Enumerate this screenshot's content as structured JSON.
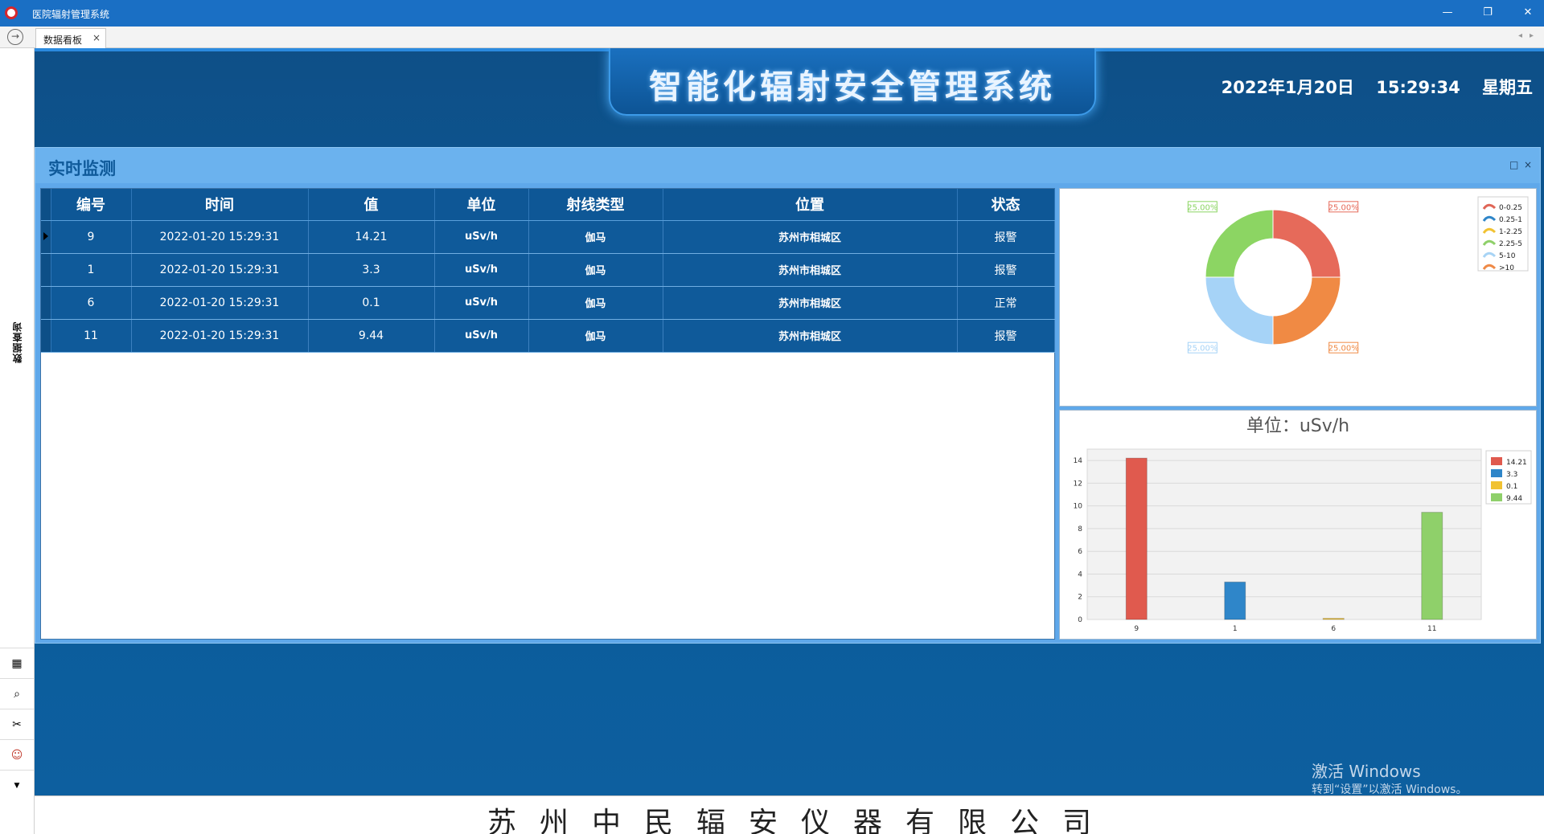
{
  "window": {
    "title": "医院辐射管理系统",
    "buttons": {
      "minimize": "—",
      "restore": "❐",
      "close": "✕"
    }
  },
  "tabs": [
    {
      "label": "数据看板",
      "close": "×"
    }
  ],
  "sidebar": {
    "vertical_label": "数据查询",
    "icons": [
      "chart-icon",
      "search-doc-icon",
      "tools-icon",
      "users-icon",
      "chevron-down-icon"
    ]
  },
  "header": {
    "title": "智能化辐射安全管理系统",
    "date": "2022年1月20日",
    "time": "15:29:34",
    "weekday": "星期五"
  },
  "panel": {
    "title": "实时监测",
    "controls": {
      "maximize": "□",
      "close": "×"
    }
  },
  "grid": {
    "columns": [
      "编号",
      "时间",
      "值",
      "单位",
      "射线类型",
      "位置",
      "状态"
    ],
    "rows": [
      [
        "9",
        "2022-01-20 15:29:31",
        "14.21",
        "uSv/h",
        "伽马",
        "苏州市相城区",
        "报警"
      ],
      [
        "1",
        "2022-01-20 15:29:31",
        "3.3",
        "uSv/h",
        "伽马",
        "苏州市相城区",
        "报警"
      ],
      [
        "6",
        "2022-01-20 15:29:31",
        "0.1",
        "uSv/h",
        "伽马",
        "苏州市相城区",
        "正常"
      ],
      [
        "11",
        "2022-01-20 15:29:31",
        "9.44",
        "uSv/h",
        "伽马",
        "苏州市相城区",
        "报警"
      ]
    ]
  },
  "chart_data": [
    {
      "type": "pie",
      "donut": true,
      "legend": [
        "0-0.25",
        "0.25-1",
        "1-2.25",
        "2.25-5",
        "5-10",
        ">10"
      ],
      "legend_colors": [
        "#e06657",
        "#2f86c9",
        "#f1c232",
        "#8fd06a",
        "#a8d4f5",
        "#ef8a47"
      ],
      "legend_position": "top-right",
      "slices": [
        {
          "label": "25.00%",
          "value": 25,
          "color": "#e66a5a"
        },
        {
          "label": "25.00%",
          "value": 25,
          "color": "#f08a44"
        },
        {
          "label": "25.00%",
          "value": 25,
          "color": "#a6d3f7"
        },
        {
          "label": "25.00%",
          "value": 25,
          "color": "#8cd563"
        }
      ]
    },
    {
      "type": "bar",
      "title": "单位：uSv/h",
      "categories": [
        "9",
        "1",
        "6",
        "11"
      ],
      "values": [
        14.21,
        3.3,
        0.1,
        9.44
      ],
      "colors": [
        "#e05a4e",
        "#2f86c9",
        "#f1c232",
        "#8fd06a"
      ],
      "legend": [
        "14.21",
        "3.3",
        "0.1",
        "9.44"
      ],
      "legend_position": "top-right",
      "ylim": [
        0,
        15
      ],
      "yticks": [
        0,
        2,
        4,
        6,
        8,
        10,
        12,
        14
      ],
      "grid": true
    }
  ],
  "watermark": {
    "line1": "激活 Windows",
    "line2": "转到“设置”以激活 Windows。"
  },
  "footer": {
    "company": "苏州中民辐安仪器有限公司"
  }
}
